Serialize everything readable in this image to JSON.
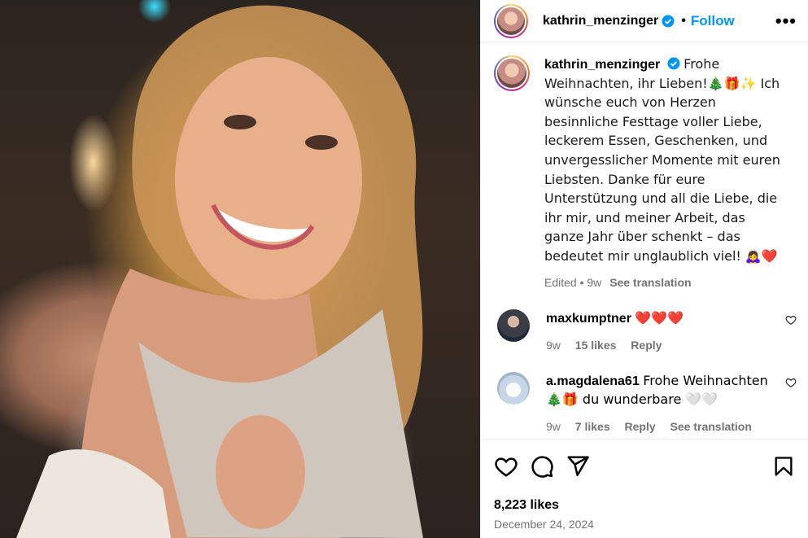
{
  "post": {
    "username": "kathrin_menzinger",
    "follow_label": "Follow",
    "more_label": "•••",
    "separator": "•",
    "caption_text": "Frohe Weihnachten, ihr Lieben!🎄🎁✨ Ich wünsche euch von Herzen besinnliche Festtage voller Liebe, leckerem Essen, Geschenken, und unvergesslicher Momente mit euren Liebsten. Danke für eure Unterstützung und all die Liebe, die ihr mir, und meiner Arbeit, das ganze Jahr über schenkt – das bedeutet mir unglaublich viel! 🙇‍♀️❤️",
    "edited_label": "Edited",
    "time": "9w",
    "see_translation": "See translation",
    "likes": "8,223 likes",
    "date": "December 24, 2024"
  },
  "comments": [
    {
      "username": "maxkumptner",
      "text": "❤️❤️❤️",
      "time": "9w",
      "likes": "15 likes",
      "reply": "Reply"
    },
    {
      "username": "a.magdalena61",
      "text": "Frohe Weihnachten 🎄🎁 du wunderbare 🤍🤍",
      "time": "9w",
      "likes": "7 likes",
      "reply": "Reply",
      "see_translation": "See translation"
    }
  ],
  "icons": {
    "verified": "verified-badge-icon",
    "like": "heart-icon",
    "comment": "comment-icon",
    "share": "share-icon",
    "save": "bookmark-icon"
  },
  "colors": {
    "accent": "#0095f6",
    "muted": "#737373",
    "border": "#efefef"
  }
}
